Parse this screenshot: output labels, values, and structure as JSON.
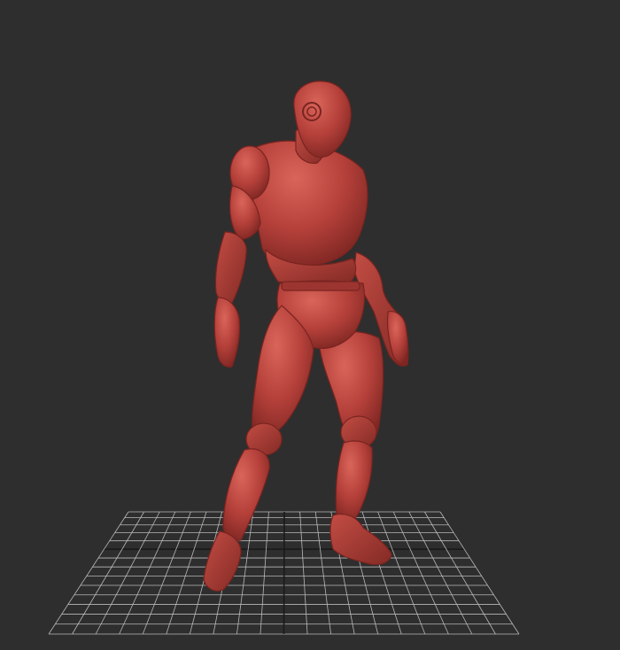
{
  "viewport": {
    "background_color": "#2e2e2e",
    "grid_color": "#b9b9b9",
    "grid_axis_color": "#1a1a1a"
  },
  "model": {
    "type": "posed humanoid mannequin sculpt",
    "material_color": "#b5403a"
  }
}
